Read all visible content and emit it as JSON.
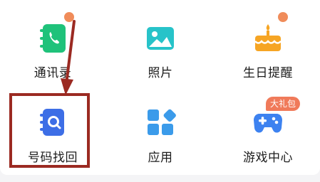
{
  "colors": {
    "notification_dot": "#f08c5a",
    "badge_bg": "#f07a5a",
    "highlight_border": "#9b2a22",
    "contacts_icon": "#1fc27a",
    "photos_icon": "#27c3c9",
    "birthday_icon": "#f6a524",
    "recover_icon": "#3d6ee6",
    "apps_icon": "#3b9bea",
    "games_icon": "#3d82f0"
  },
  "grid": {
    "items": [
      {
        "label": "通讯录",
        "icon": "contacts-book-icon",
        "has_dot": true
      },
      {
        "label": "照片",
        "icon": "photo-icon",
        "has_dot": false
      },
      {
        "label": "生日提醒",
        "icon": "birthday-cake-icon",
        "has_dot": true
      },
      {
        "label": "号码找回",
        "icon": "number-recover-icon",
        "has_dot": false
      },
      {
        "label": "应用",
        "icon": "apps-grid-icon",
        "has_dot": false
      },
      {
        "label": "游戏中心",
        "icon": "gamepad-icon",
        "has_dot": false,
        "badge": "大礼包"
      }
    ]
  }
}
